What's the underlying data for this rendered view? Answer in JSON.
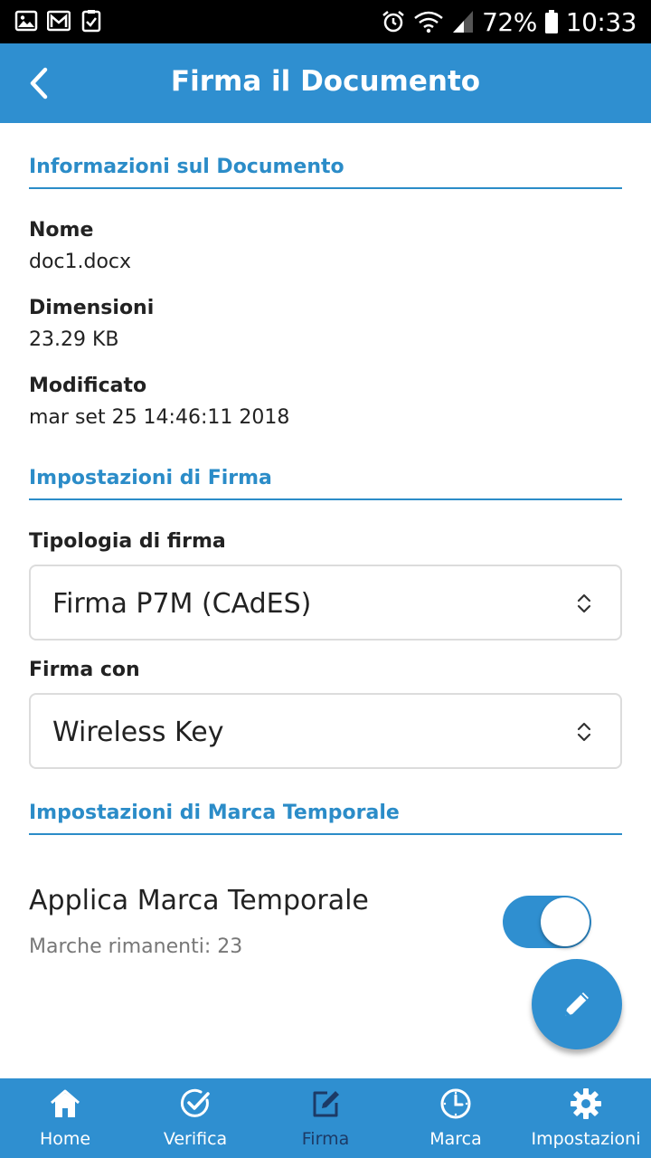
{
  "status_bar": {
    "battery": "72%",
    "time": "10:33"
  },
  "app_bar": {
    "title": "Firma il Documento"
  },
  "document_info": {
    "header": "Informazioni sul Documento",
    "name_label": "Nome",
    "name_value": "doc1.docx",
    "size_label": "Dimensioni",
    "size_value": "23.29 KB",
    "modified_label": "Modificato",
    "modified_value": "mar set 25 14:46:11 2018"
  },
  "signature_settings": {
    "header": "Impostazioni di Firma",
    "type_label": "Tipologia di firma",
    "type_value": "Firma P7M (CAdES)",
    "sign_with_label": "Firma con",
    "sign_with_value": "Wireless Key"
  },
  "timestamp_settings": {
    "header": "Impostazioni di Marca Temporale",
    "apply_label": "Applica Marca Temporale",
    "remaining_text": "Marche rimanenti: 23",
    "apply_enabled": true
  },
  "bottom_nav": {
    "items": [
      {
        "label": "Home",
        "icon": "home-icon"
      },
      {
        "label": "Verifica",
        "icon": "check-circle-icon"
      },
      {
        "label": "Firma",
        "icon": "edit-icon",
        "active": true
      },
      {
        "label": "Marca",
        "icon": "clock-icon"
      },
      {
        "label": "Impostazioni",
        "icon": "gear-icon"
      }
    ]
  },
  "colors": {
    "primary": "#2f8fd0",
    "section_header": "#2b8cc8",
    "active_nav": "#1c3a66"
  }
}
